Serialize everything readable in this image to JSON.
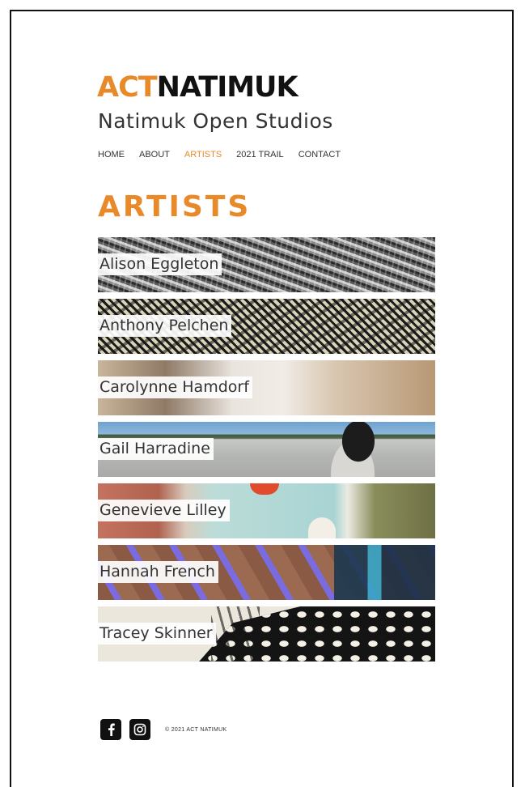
{
  "header": {
    "logo_part1": "ACT",
    "logo_part2": "NATIMUK",
    "subtitle": "Natimuk Open Studios"
  },
  "nav": {
    "items": [
      {
        "label": "HOME"
      },
      {
        "label": "ABOUT"
      },
      {
        "label": "ARTISTS",
        "active": true
      },
      {
        "label": "2021 TRAIL"
      },
      {
        "label": "CONTACT"
      }
    ]
  },
  "page": {
    "heading": "ARTISTS"
  },
  "artists": [
    {
      "name": "Alison Eggleton"
    },
    {
      "name": "Anthony Pelchen"
    },
    {
      "name": "Carolynne Hamdorf"
    },
    {
      "name": "Gail Harradine"
    },
    {
      "name": "Genevieve Lilley"
    },
    {
      "name": "Hannah French"
    },
    {
      "name": "Tracey Skinner"
    }
  ],
  "footer": {
    "social": [
      {
        "icon": "facebook-icon"
      },
      {
        "icon": "instagram-icon"
      }
    ],
    "copyright": "© 2021 ACT NATIMUK"
  },
  "colors": {
    "accent": "#e8892a",
    "text": "#333333"
  }
}
